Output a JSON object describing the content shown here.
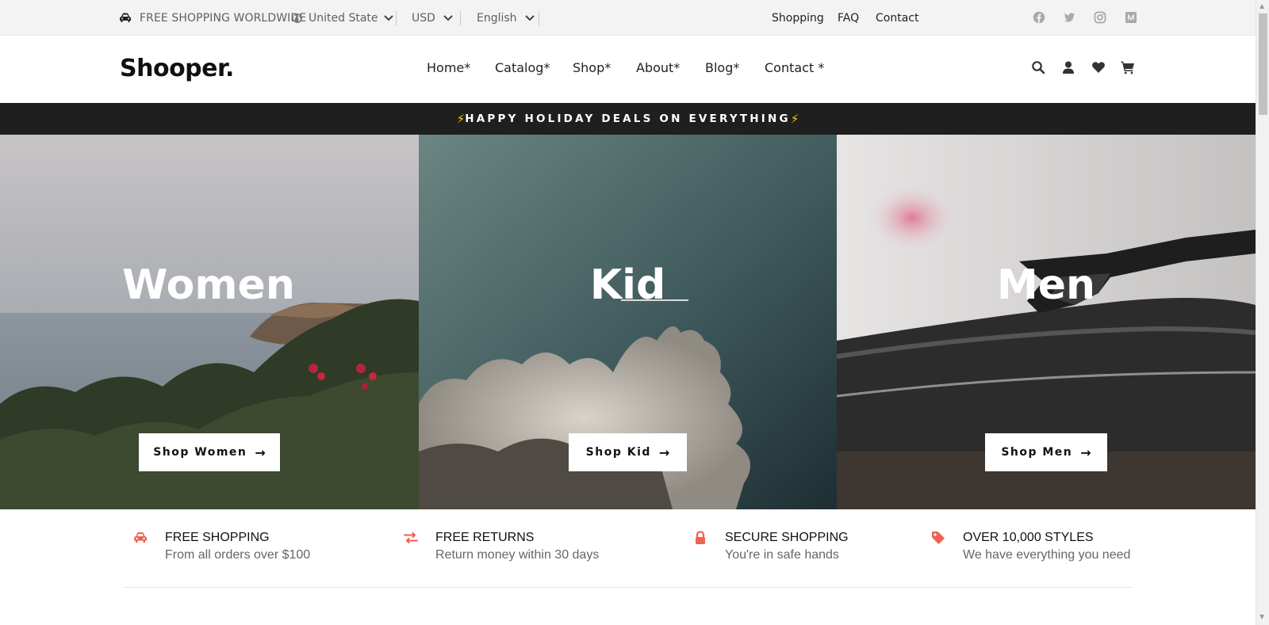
{
  "topbar": {
    "free_shipping": "FREE SHOPPING WORLDWIDE",
    "country": "United State",
    "currency": "USD",
    "language": "English",
    "links": [
      "Shopping",
      "FAQ",
      "Contact"
    ],
    "social_icons": [
      "facebook-icon",
      "twitter-icon",
      "instagram-icon",
      "medium-icon"
    ]
  },
  "header": {
    "logo": "Shooper.",
    "nav": [
      "Home*",
      "Catalog*",
      "Shop*",
      "About*",
      "Blog*",
      "Contact *"
    ],
    "icons": [
      "search-icon",
      "user-icon",
      "heart-icon",
      "cart-icon"
    ]
  },
  "promo": {
    "text": "HAPPY HOLIDAY DEALS ON EVERYTHING",
    "bolt": "⚡"
  },
  "panels": [
    {
      "title": "Women",
      "button": "Shop Women",
      "arrow": "→"
    },
    {
      "title": "Kid",
      "button": "Shop Kid",
      "arrow": "→"
    },
    {
      "title": "Men",
      "button": "Shop Men",
      "arrow": "→"
    }
  ],
  "features": [
    {
      "icon": "car-icon",
      "title": "FREE SHOPPING",
      "subtitle": "From all orders over $100"
    },
    {
      "icon": "exchange-icon",
      "title": "FREE RETURNS",
      "subtitle": "Return money within 30 days"
    },
    {
      "icon": "lock-icon",
      "title": "SECURE SHOPPING",
      "subtitle": "You're in safe hands"
    },
    {
      "icon": "tag-icon",
      "title": "OVER 10,000 STYLES",
      "subtitle": "We have everything you need"
    }
  ],
  "colors": {
    "accent": "#ef6253",
    "promo_bg": "#1f1f1f",
    "bolt": "#f2d21b"
  }
}
